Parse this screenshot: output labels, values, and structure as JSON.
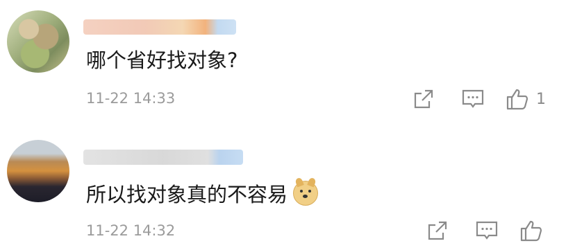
{
  "comments": [
    {
      "username": "",
      "text": "哪个省好找对象?",
      "timestamp": "11-22 14:33",
      "likes": "1"
    },
    {
      "username": "",
      "text": "所以找对象真的不容易",
      "emoji": "doge-icon",
      "timestamp": "11-22 14:32",
      "likes": ""
    }
  ],
  "colors": {
    "text": "#1a1a1a",
    "meta": "#9b9b9b",
    "icon": "#8a8a8a"
  }
}
